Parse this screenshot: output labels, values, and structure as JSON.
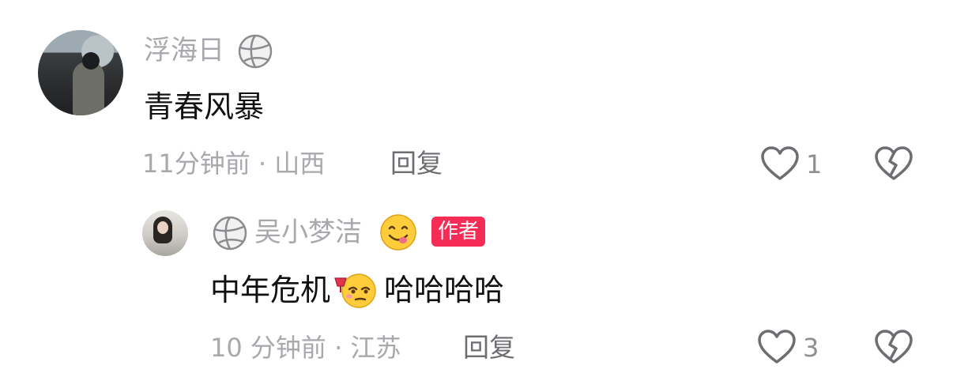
{
  "comments": [
    {
      "username": "浮海日",
      "text": "青春风暴",
      "time": "11分钟前",
      "separator": "·",
      "location": "山西",
      "reply_label": "回复",
      "like_count": "1",
      "icons": [
        "volleyball-icon",
        "heart-icon",
        "dislike-icon"
      ]
    }
  ],
  "replies": [
    {
      "username": "吴小梦洁",
      "badge": "作者",
      "text_before_emoji": "中年危机",
      "text_after_emoji": "哈哈哈哈",
      "time": "10 分钟前",
      "separator": "·",
      "location": "江苏",
      "reply_label": "回复",
      "like_count": "3",
      "icons": [
        "volleyball-icon",
        "smile-emoji-icon",
        "drunk-emoji-icon",
        "heart-icon",
        "dislike-icon"
      ]
    }
  ],
  "colors": {
    "badge": "#f52c55",
    "secondary_text": "#a8a8ad",
    "primary_text": "#111111"
  }
}
